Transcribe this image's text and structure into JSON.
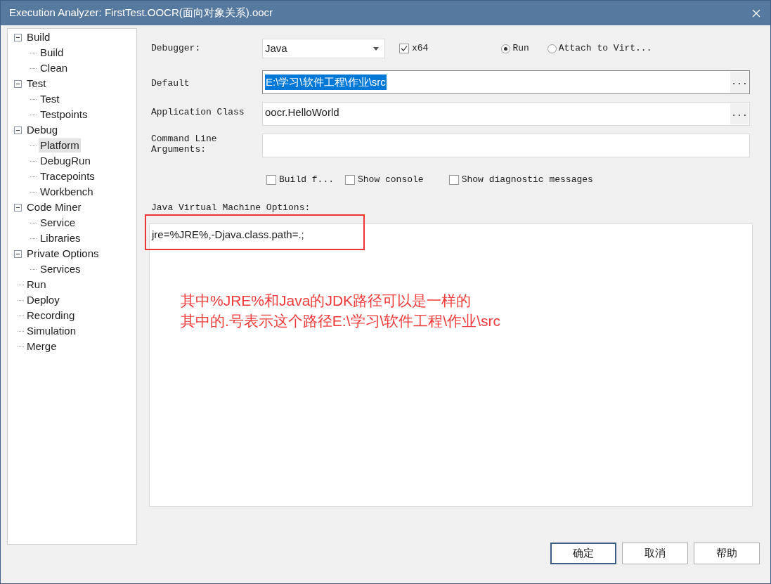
{
  "window": {
    "title": "Execution Analyzer: FirstTest.OOCR(面向对象关系).oocr"
  },
  "tree": [
    {
      "label": "Build",
      "expanded": true,
      "selected": false,
      "children": [
        {
          "label": "Build",
          "selected": false
        },
        {
          "label": "Clean",
          "selected": false
        }
      ]
    },
    {
      "label": "Test",
      "expanded": true,
      "selected": false,
      "children": [
        {
          "label": "Test",
          "selected": false
        },
        {
          "label": "Testpoints",
          "selected": false
        }
      ]
    },
    {
      "label": "Debug",
      "expanded": true,
      "selected": false,
      "children": [
        {
          "label": "Platform",
          "selected": true
        },
        {
          "label": "DebugRun",
          "selected": false
        },
        {
          "label": "Tracepoints",
          "selected": false
        },
        {
          "label": "Workbench",
          "selected": false
        }
      ]
    },
    {
      "label": "Code Miner",
      "expanded": true,
      "selected": false,
      "children": [
        {
          "label": "Service",
          "selected": false
        },
        {
          "label": "Libraries",
          "selected": false
        }
      ]
    },
    {
      "label": "Private Options",
      "expanded": true,
      "selected": false,
      "children": [
        {
          "label": "Services",
          "selected": false
        }
      ]
    },
    {
      "label": "Run",
      "selected": false
    },
    {
      "label": "Deploy",
      "selected": false
    },
    {
      "label": "Recording",
      "selected": false
    },
    {
      "label": "Simulation",
      "selected": false
    },
    {
      "label": "Merge",
      "selected": false
    }
  ],
  "debugger": {
    "label": "Debugger:",
    "value": "Java"
  },
  "x64": {
    "label": "x64",
    "checked": true
  },
  "modes": [
    {
      "label": "Run",
      "selected": true
    },
    {
      "label": "Attach to Virt...",
      "selected": false
    }
  ],
  "default_directory": {
    "label": "Default",
    "value": "E:\\学习\\软件工程\\作业\\src",
    "highlighted": true,
    "browse": "..."
  },
  "application_class": {
    "label": "Application Class",
    "value": "oocr.HelloWorld",
    "browse": "..."
  },
  "command_line": {
    "label": "Command Line Arguments:"
  },
  "options": [
    {
      "label": "Build f...",
      "checked": false
    },
    {
      "label": "Show console",
      "checked": false
    },
    {
      "label": "Show diagnostic messages",
      "checked": false
    }
  ],
  "jvm_options": {
    "label": "Java Virtual Machine Options:",
    "value": "jre=%JRE%,-Djava.class.path=.;"
  },
  "annotation": {
    "lines": [
      "其中%JRE%和Java的JDK路径可以是一样的",
      "其中的.号表示这个路径E:\\学习\\软件工程\\作业\\src"
    ]
  },
  "buttons": [
    "确定",
    "取消",
    "帮助"
  ]
}
